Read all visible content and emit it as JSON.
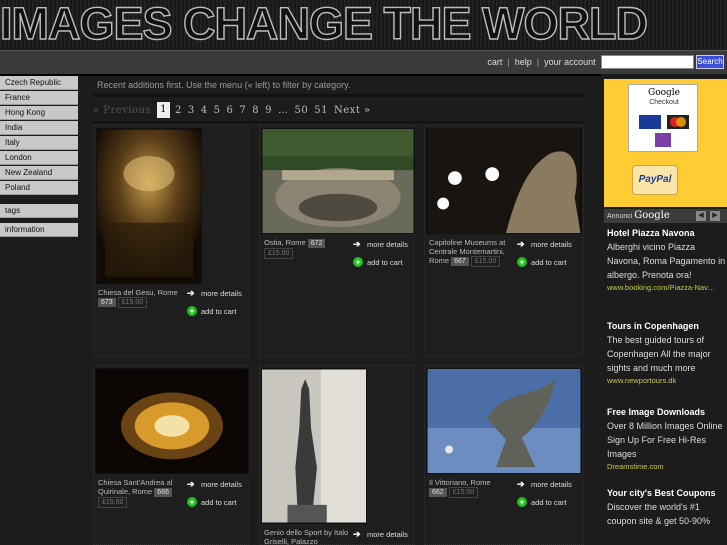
{
  "site": {
    "title": "IMAGES CHANGE THE WORLD"
  },
  "top_links": {
    "cart": "cart",
    "sep": "|",
    "help": "help",
    "account": "your account"
  },
  "search": {
    "placeholder": "",
    "button": "Search"
  },
  "sidebar": {
    "countries": [
      "Czech Republic",
      "France",
      "Hong Kong",
      "India",
      "Italy",
      "London",
      "New Zealand",
      "Poland"
    ],
    "tags": "tags",
    "information": "information"
  },
  "main": {
    "intro": "Recent additions first. Use the menu (« left) to filter by category.",
    "pager": {
      "prev": "« Previous",
      "current": "1",
      "pages": [
        "2",
        "3",
        "4",
        "5",
        "6",
        "7",
        "8",
        "9"
      ],
      "ellipsis": "…",
      "tail": [
        "50",
        "51"
      ],
      "next": "Next »"
    },
    "more_label": "more details",
    "cart_label": "add to cart",
    "items": [
      {
        "title": "Chiesa del Gesu, Rome",
        "id": "673",
        "price": "£15.00"
      },
      {
        "title": "Ostia, Rome",
        "id": "672",
        "price": "£15.00"
      },
      {
        "title": "Capitoline Museums at Centrale Montemartini, Rome",
        "id": "667",
        "price": "£15.00"
      },
      {
        "title": "Chiesa Sant'Andrea al Quirinale, Rome",
        "id": "666",
        "price": "£15.00"
      },
      {
        "title": "Genio dello Sport by Italo Griselli, Palazzo",
        "id": "",
        "price": ""
      },
      {
        "title": "Il Vittoriano, Rome",
        "id": "662",
        "price": "£15.00"
      }
    ]
  },
  "right": {
    "google_checkout": {
      "title": "Google",
      "sub": "Checkout"
    },
    "paypal": "PayPal",
    "ads_header": {
      "prefix": "Annunci",
      "brand": "Google"
    },
    "ads": [
      {
        "title": "Hotel Piazza Navona",
        "body": "Alberghi vicino Piazza Navona, Roma Pagamento in albergo. Prenota ora!",
        "url": "www.booking.com/Piazza-Nav…"
      },
      {
        "title": "Tours in Copenhagen",
        "body": "The best guided tours of Copenhagen All the major sights and much more",
        "url": "www.newportours.dk"
      },
      {
        "title": "Free Image Downloads",
        "body": "Over 8 Million Images Online Sign Up For Free Hi-Res Images",
        "url": "Dreamstime.com"
      },
      {
        "title": "Your city's Best Coupons",
        "body": "Discover the world's #1 coupon site & get 50-90%",
        "url": ""
      }
    ]
  },
  "colors": {
    "accent": "#ffcc33",
    "search_btn": "#3b4fd8",
    "plus": "#1fbf1f"
  }
}
